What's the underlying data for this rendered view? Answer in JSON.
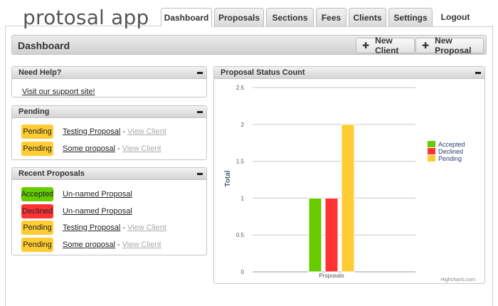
{
  "app": {
    "title": "protosal app"
  },
  "nav": {
    "tabs": [
      {
        "label": "Dashboard",
        "active": true
      },
      {
        "label": "Proposals",
        "active": false
      },
      {
        "label": "Sections",
        "active": false
      },
      {
        "label": "Fees",
        "active": false
      },
      {
        "label": "Clients",
        "active": false
      },
      {
        "label": "Settings",
        "active": false
      }
    ],
    "logout": "Logout"
  },
  "header": {
    "title": "Dashboard",
    "new_client": "New Client",
    "new_proposal": "New Proposal"
  },
  "help_panel": {
    "title": "Need Help?",
    "link": "Visit our support site!"
  },
  "pending_panel": {
    "title": "Pending",
    "items": [
      {
        "status": "Pending",
        "name": "Testing Proposal",
        "separator": "-",
        "action": "View Client"
      },
      {
        "status": "Pending",
        "name": "Some proposal",
        "separator": "-",
        "action": "View Client"
      }
    ]
  },
  "recent_panel": {
    "title": "Recent Proposals",
    "items": [
      {
        "status": "Accepted",
        "name": "Un-named Proposal",
        "separator": "",
        "action": ""
      },
      {
        "status": "Declined",
        "name": "Un-named Proposal",
        "separator": "",
        "action": ""
      },
      {
        "status": "Pending",
        "name": "Testing Proposal",
        "separator": "-",
        "action": "View Client"
      },
      {
        "status": "Pending",
        "name": "Some proposal",
        "separator": "-",
        "action": "View Client"
      }
    ]
  },
  "status_colors": {
    "Accepted": "#66cc00",
    "Declined": "#ff3333",
    "Pending": "#ffcc33"
  },
  "chart_panel": {
    "title": "Proposal Status Count",
    "credit": "Highcharts.com"
  },
  "chart_data": {
    "type": "bar",
    "categories": [
      "Proposals"
    ],
    "series": [
      {
        "name": "Accepted",
        "values": [
          1
        ],
        "color": "#66cc00"
      },
      {
        "name": "Declined",
        "values": [
          1
        ],
        "color": "#ff3333"
      },
      {
        "name": "Pending",
        "values": [
          2
        ],
        "color": "#ffcc33"
      }
    ],
    "ylabel": "Total",
    "xlabel": "",
    "ylim": [
      0,
      2.5
    ],
    "yticks": [
      "0",
      "0.5",
      "1",
      "1.5",
      "2",
      "2.5"
    ],
    "grid": true,
    "legend": "right"
  }
}
